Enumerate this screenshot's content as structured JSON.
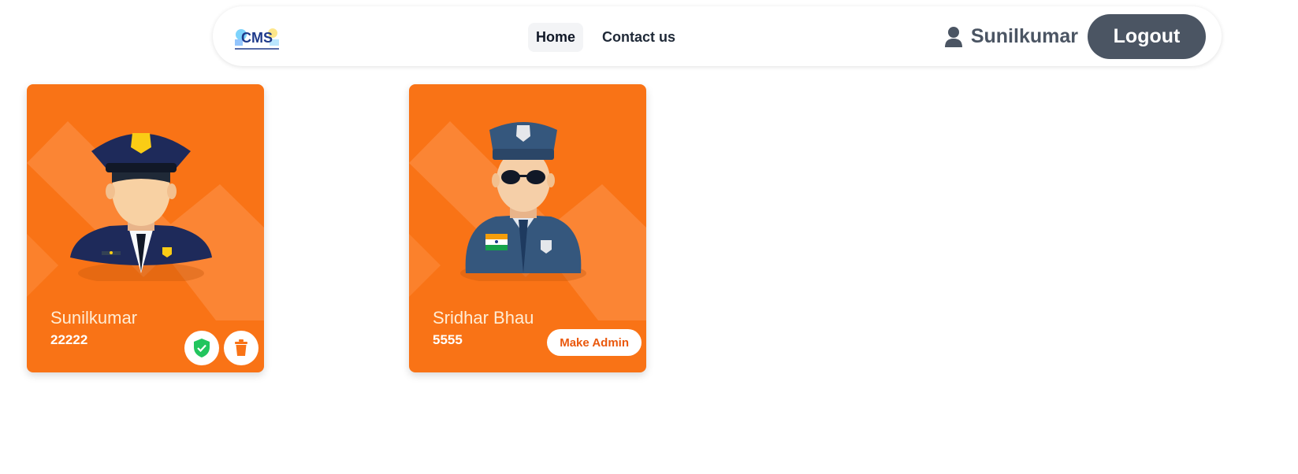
{
  "nav": {
    "logo_text": "CMS",
    "links": [
      "Home",
      "Contact us"
    ],
    "user_name": "Sunilkumar",
    "logout_label": "Logout"
  },
  "cards": [
    {
      "name": "Sunilkumar",
      "number": "22222",
      "avatar": "police-officer-navy-cap-icon",
      "actions": [
        "verified-shield-icon",
        "trash-icon"
      ]
    },
    {
      "name": "Sridhar Bhau",
      "number": "5555",
      "avatar": "police-officer-sunglasses-icon",
      "action_label": "Make Admin"
    }
  ],
  "colors": {
    "card_bg": "#f97316",
    "nav_button": "#4b5563",
    "admin_text": "#ea580c",
    "shield": "#22c55e"
  }
}
